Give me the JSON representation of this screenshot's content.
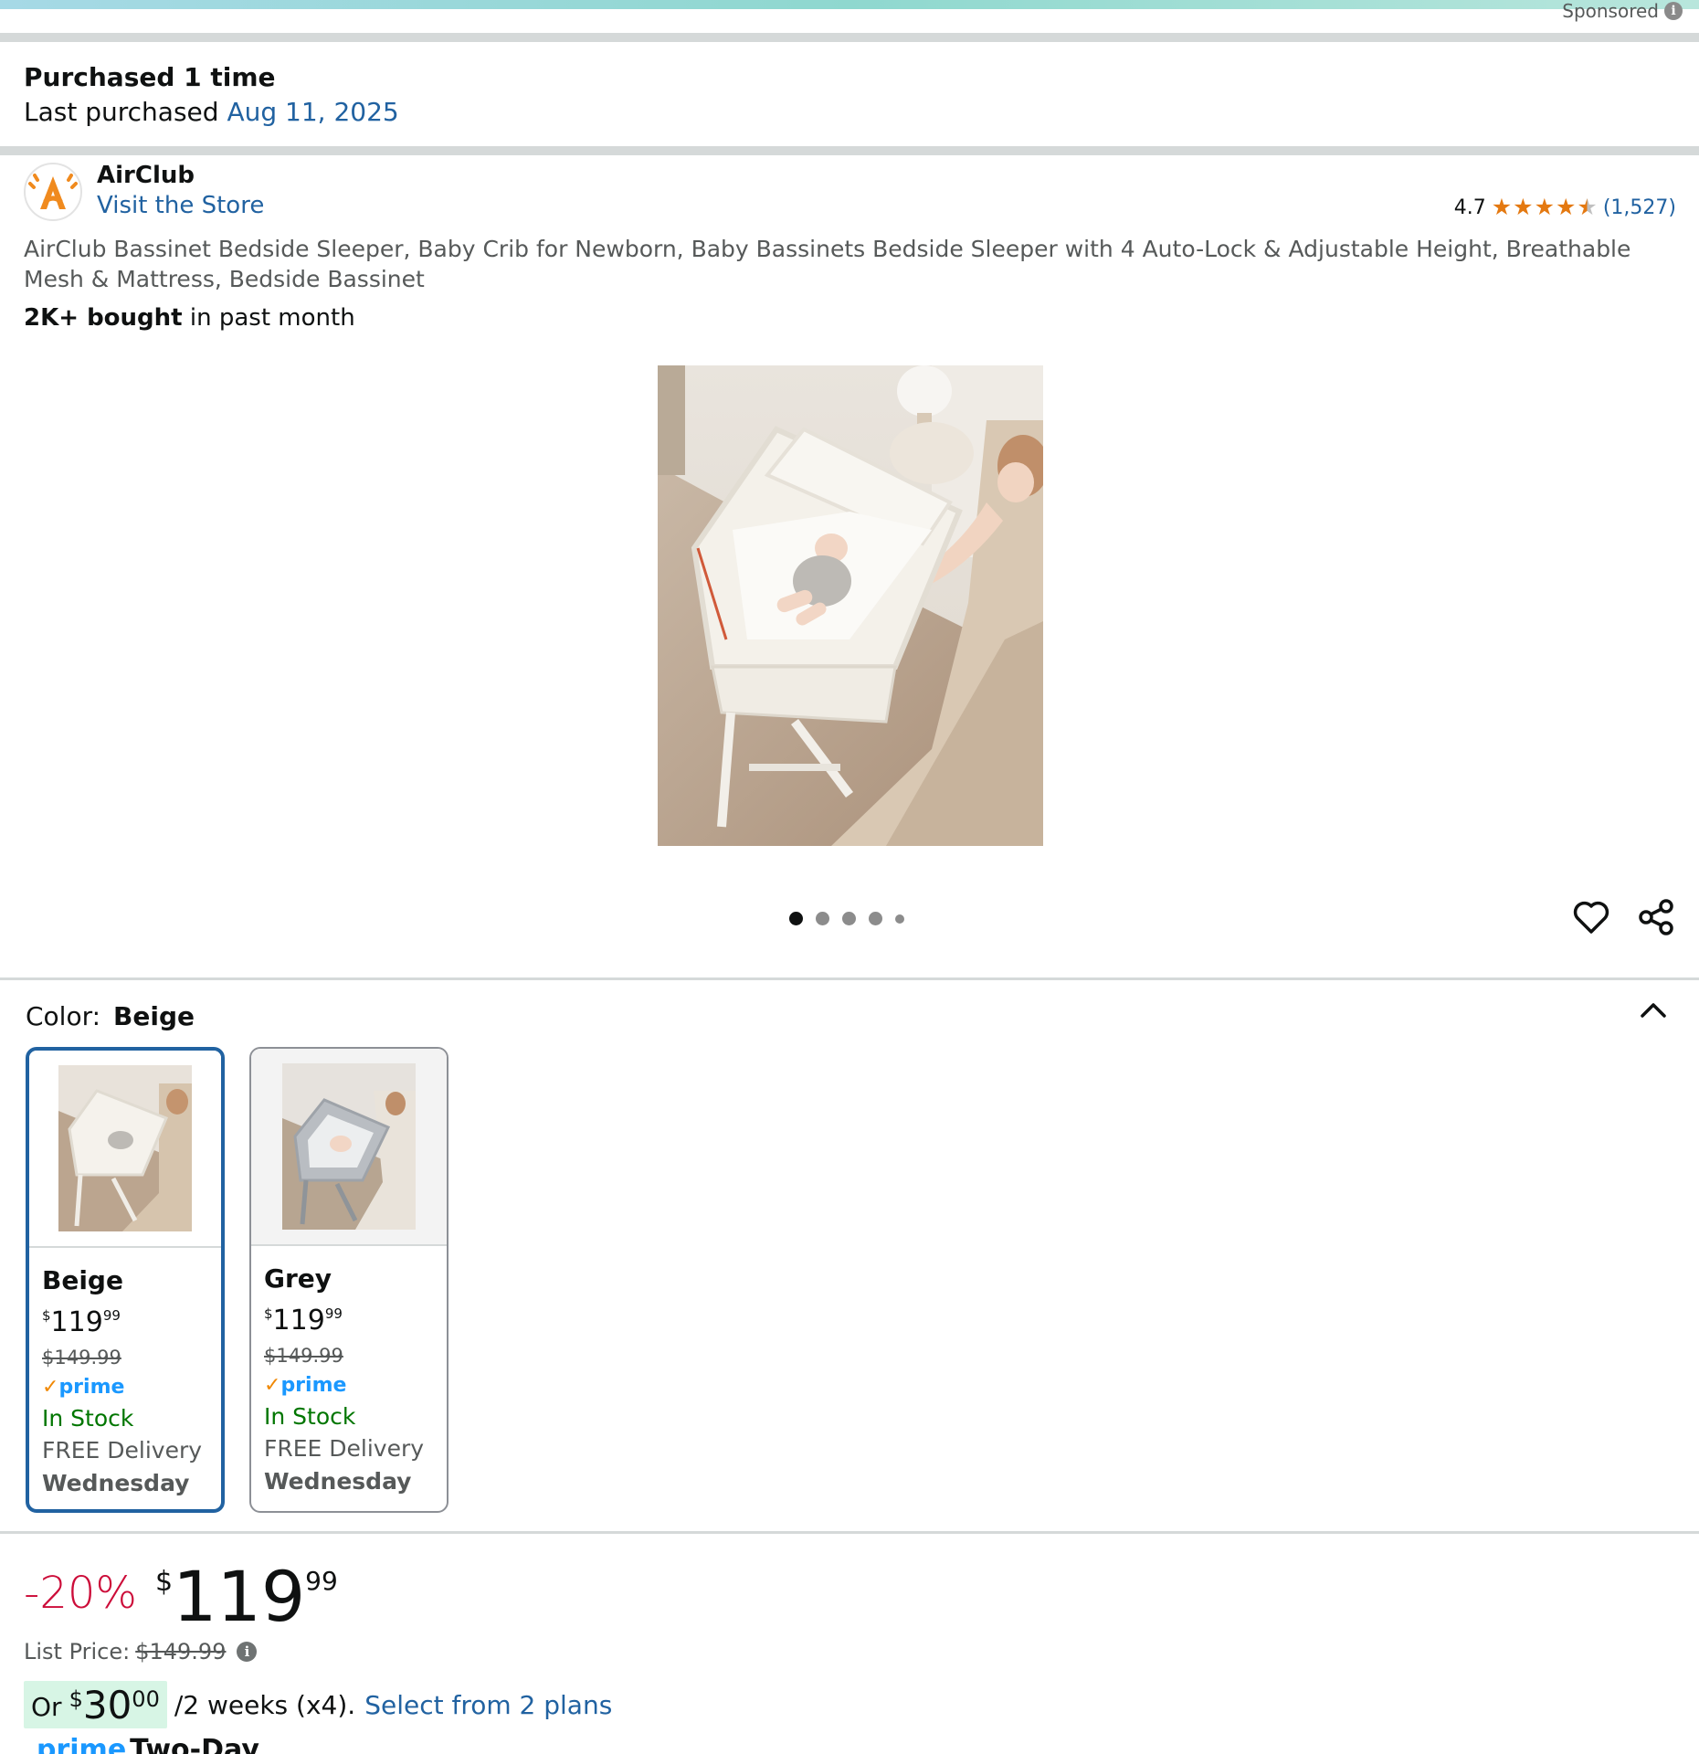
{
  "sponsored": {
    "label": "Sponsored",
    "info_glyph": "i"
  },
  "purchase_history": {
    "count_label": "Purchased 1 time",
    "last_prefix": "Last purchased ",
    "last_date": "Aug 11, 2025"
  },
  "brand": {
    "name": "AirClub",
    "store_link": "Visit the Store",
    "logo_icon": "airclub-logo"
  },
  "rating": {
    "value": "4.7",
    "stars": 4.7,
    "count": "(1,527)"
  },
  "product": {
    "title": "AirClub Bassinet Bedside Sleeper, Baby Crib for Newborn, Baby Bassinets Bedside Sleeper with 4 Auto-Lock & Adjustable Height, Breathable Mesh & Mattress, Bedside Bassinet",
    "bought_bold": "2K+ bought",
    "bought_rest": " in past month"
  },
  "gallery": {
    "image_count": 5,
    "active_index": 0
  },
  "color_selector": {
    "label": "Color:",
    "selected": "Beige",
    "options": [
      {
        "name": "Beige",
        "currency": "$",
        "whole": "119",
        "fraction": "99",
        "list_price": "$149.99",
        "prime": "prime",
        "stock": "In Stock",
        "delivery": "FREE Delivery",
        "day": "Wednesday"
      },
      {
        "name": "Grey",
        "currency": "$",
        "whole": "119",
        "fraction": "99",
        "list_price": "$149.99",
        "prime": "prime",
        "stock": "In Stock",
        "delivery": "FREE Delivery",
        "day": "Wednesday"
      }
    ]
  },
  "price": {
    "discount": "-20%",
    "currency": "$",
    "whole": "119",
    "fraction": "99",
    "list_label": "List Price:",
    "list_value": "$149.99"
  },
  "installment": {
    "prefix": "Or",
    "currency": "$",
    "whole": "30",
    "fraction": "00",
    "rest": "/2 weeks (x4).",
    "link": "Select from 2 plans"
  },
  "delivery_cut": {
    "prime": "prime",
    "text": "Two-Day"
  },
  "colors": {
    "link": "#2162a1",
    "discount": "#cc0c39",
    "in_stock": "#007600",
    "star": "#e47911",
    "selected_border": "#2162a1"
  }
}
